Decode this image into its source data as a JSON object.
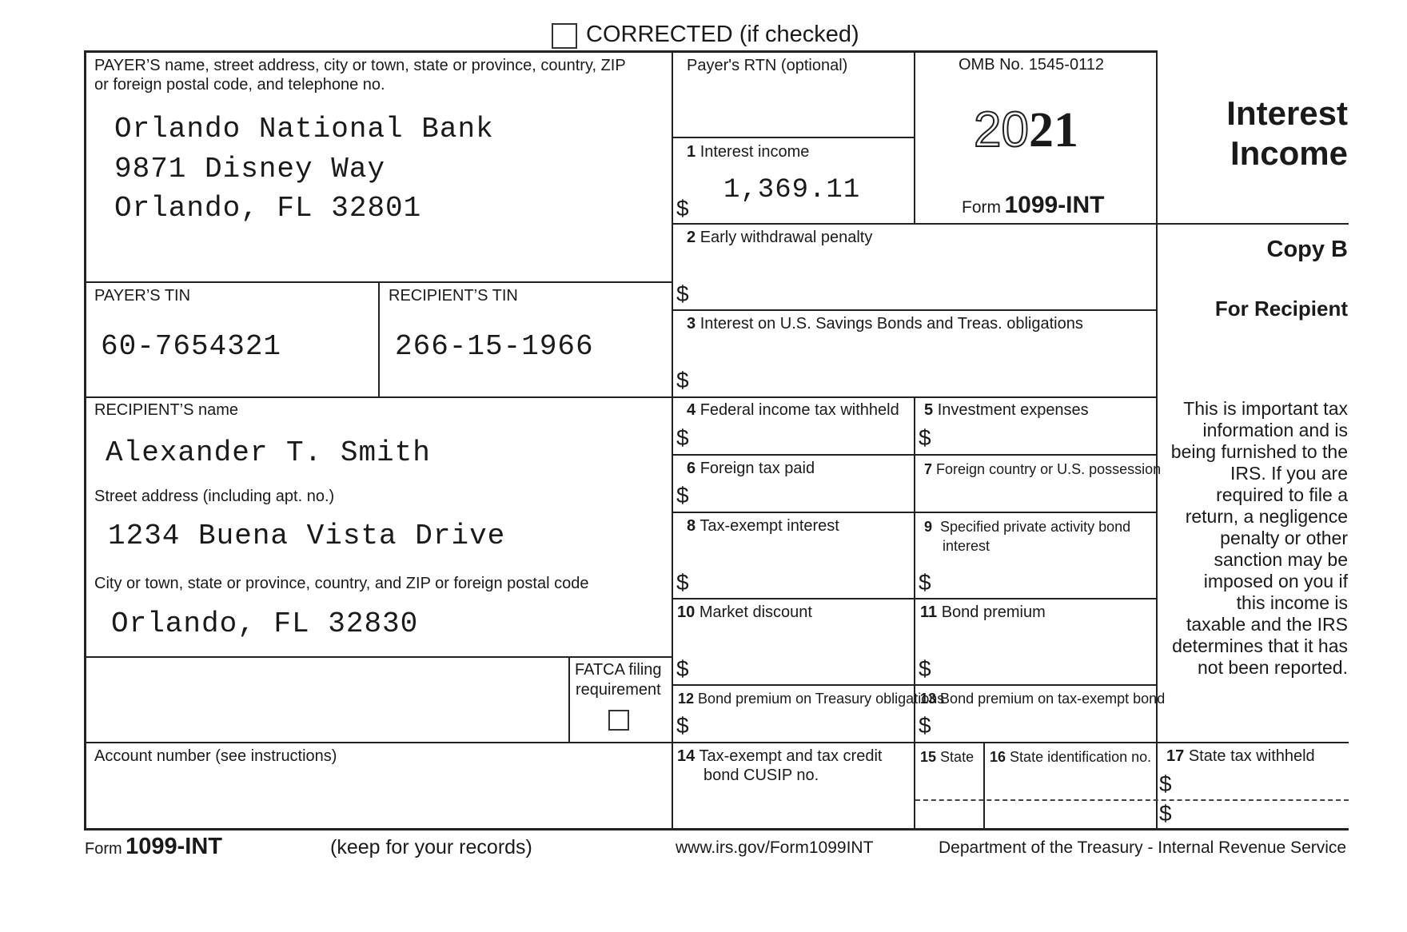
{
  "header": {
    "corrected_label": "CORRECTED (if checked)",
    "corrected_checked": false
  },
  "payer": {
    "label_line1": "PAYER’S name, street address, city or town, state or province, country, ZIP",
    "label_line2": "or foreign postal code, and telephone no.",
    "name": "Orlando National Bank",
    "street": "9871 Disney Way",
    "city": "Orlando, FL 32801",
    "tin_label": "PAYER’S TIN",
    "tin": "60-7654321"
  },
  "recipient": {
    "tin_label": "RECIPIENT’S TIN",
    "tin": "266-15-1966",
    "name_label": "RECIPIENT’S name",
    "name": "Alexander T. Smith",
    "street_label": "Street address (including apt. no.)",
    "street": "1234 Buena Vista Drive",
    "city_label": "City or town, state or province, country, and ZIP or foreign postal code",
    "city": "Orlando, FL 32830"
  },
  "fatca": {
    "label_line1": "FATCA filing",
    "label_line2": "requirement",
    "checked": false
  },
  "account": {
    "label": "Account number (see instructions)",
    "value": ""
  },
  "rtn": {
    "label": "Payer's RTN (optional)",
    "value": ""
  },
  "omb": {
    "omb_label": "OMB No. 1545-0112",
    "year_outline": "20",
    "year_bold": "21",
    "form_prefix": "Form",
    "form_name": "1099-INT"
  },
  "title": {
    "line1": "Interest",
    "line2": "Income",
    "copy": "Copy B",
    "for": "For Recipient",
    "notice": [
      "This is important tax",
      "information and is",
      "being furnished to the",
      "IRS. If you are",
      "required to file a",
      "return, a negligence",
      "penalty or other",
      "sanction may be",
      "imposed on you if",
      "this income is",
      "taxable and the IRS",
      "determines that it has",
      "not been reported."
    ]
  },
  "boxes": {
    "b1": {
      "num": "1",
      "label": "Interest income",
      "currency": "$",
      "value": "1,369.11"
    },
    "b2": {
      "num": "2",
      "label": "Early withdrawal penalty",
      "currency": "$",
      "value": ""
    },
    "b3": {
      "num": "3",
      "label": "Interest on U.S. Savings Bonds and Treas. obligations",
      "currency": "$",
      "value": ""
    },
    "b4": {
      "num": "4",
      "label": "Federal income tax withheld",
      "currency": "$",
      "value": ""
    },
    "b5": {
      "num": "5",
      "label": "Investment expenses",
      "currency": "$",
      "value": ""
    },
    "b6": {
      "num": "6",
      "label": "Foreign tax paid",
      "currency": "$",
      "value": ""
    },
    "b7": {
      "num": "7",
      "label": "Foreign country or U.S. possession",
      "value": ""
    },
    "b8": {
      "num": "8",
      "label": "Tax-exempt interest",
      "currency": "$",
      "value": ""
    },
    "b9": {
      "num": "9",
      "label_line1": "Specified private activity bond",
      "label_line2": "interest",
      "currency": "$",
      "value": ""
    },
    "b10": {
      "num": "10",
      "label": "Market discount",
      "currency": "$",
      "value": ""
    },
    "b11": {
      "num": "11",
      "label": "Bond premium",
      "currency": "$",
      "value": ""
    },
    "b12": {
      "num": "12",
      "label": "Bond premium on Treasury obligations",
      "currency": "$",
      "value": ""
    },
    "b13": {
      "num": "13",
      "label": "Bond premium on tax-exempt bond",
      "currency": "$",
      "value": ""
    },
    "b14": {
      "num": "14",
      "label_line1": "Tax-exempt and tax credit",
      "label_line2": "bond CUSIP no.",
      "value": ""
    },
    "b15": {
      "num": "15",
      "label": "State",
      "value": ""
    },
    "b16": {
      "num": "16",
      "label": "State identification no.",
      "value": ""
    },
    "b17": {
      "num": "17",
      "label": "State tax withheld",
      "currency": "$",
      "value": ""
    }
  },
  "footer": {
    "form_prefix": "Form",
    "form_name": "1099-INT",
    "keep": "(keep for your records)",
    "url": "www.irs.gov/Form1099INT",
    "dept": "Department of the Treasury - Internal Revenue Service"
  }
}
